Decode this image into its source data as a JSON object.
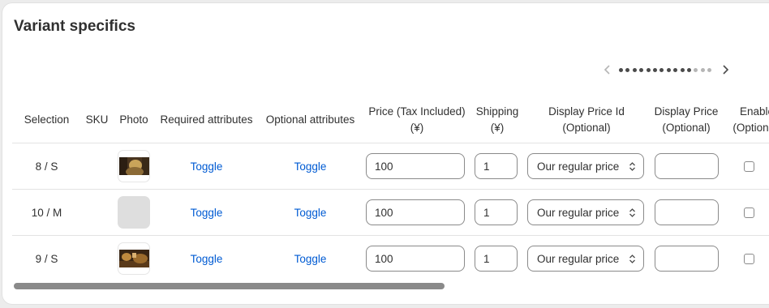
{
  "card": {
    "title": "Variant specifics"
  },
  "pager": {
    "prev_icon": "chevron-left-icon",
    "next_icon": "chevron-right-icon",
    "dots_active": 11,
    "dots_inactive": 3
  },
  "columns": {
    "selection": "Selection",
    "sku": "SKU",
    "photo": "Photo",
    "required": "Required attributes",
    "optional": "Optional attributes",
    "price_line1": "Price (Tax Included)",
    "price_line2": "(¥)",
    "shipping_line1": "Shipping",
    "shipping_line2": "(¥)",
    "display_price_id_line1": "Display Price Id",
    "display_price_id_line2": "(Optional)",
    "display_price_line1": "Display Price",
    "display_price_line2": "(Optional)",
    "enable_line1": "Enable",
    "enable_line2": "(Optional)"
  },
  "rows": [
    {
      "selection": "8 / S",
      "sku": "",
      "photo": "photo-thumbnail",
      "required": "Toggle",
      "optional": "Toggle",
      "price": "100",
      "shipping": "1",
      "display_price_id": "Our regular price",
      "display_price": "",
      "enable": false
    },
    {
      "selection": "10 / M",
      "sku": "",
      "photo": "photo-placeholder",
      "required": "Toggle",
      "optional": "Toggle",
      "price": "100",
      "shipping": "1",
      "display_price_id": "Our regular price",
      "display_price": "",
      "enable": false
    },
    {
      "selection": "9 / S",
      "sku": "",
      "photo": "photo-thumbnail",
      "required": "Toggle",
      "optional": "Toggle",
      "price": "100",
      "shipping": "1",
      "display_price_id": "Our regular price",
      "display_price": "",
      "enable": false
    }
  ],
  "colors": {
    "link": "#005bd3",
    "border": "#8a8a8a",
    "scrollbar": "#8a8a8a"
  },
  "scrollbar": {
    "visible_fraction": 0.55
  }
}
